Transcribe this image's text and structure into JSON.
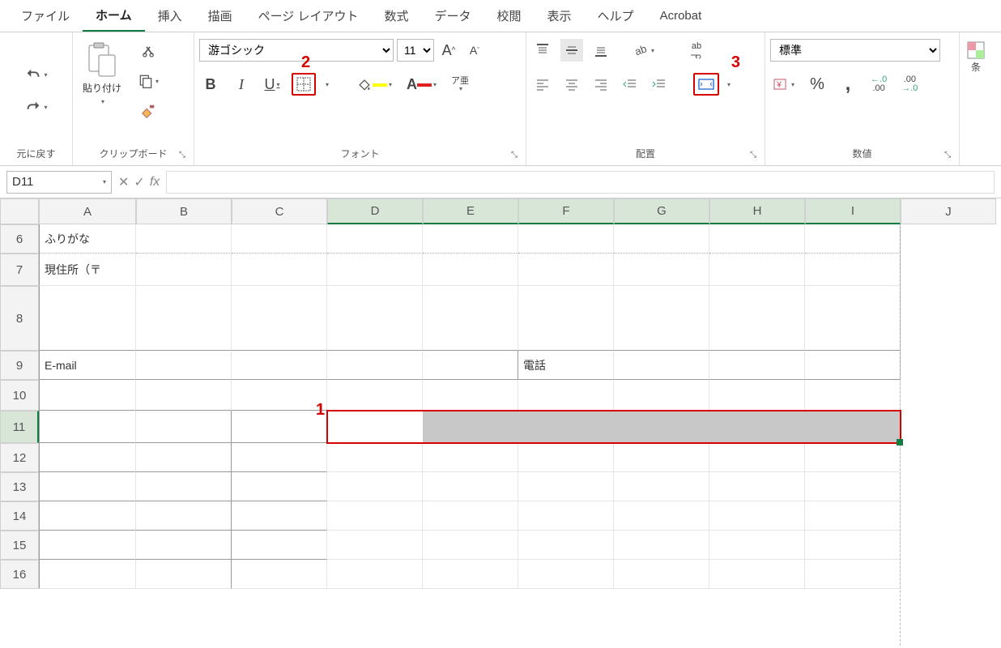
{
  "menu": {
    "items": [
      "ファイル",
      "ホーム",
      "挿入",
      "描画",
      "ページ レイアウト",
      "数式",
      "データ",
      "校閲",
      "表示",
      "ヘルプ",
      "Acrobat"
    ],
    "active_index": 1
  },
  "ribbon": {
    "undo_label": "元に戻す",
    "clipboard": {
      "paste": "貼り付け",
      "label": "クリップボード"
    },
    "font": {
      "family": "游ゴシック",
      "size": "11",
      "label": "フォント",
      "phonetic": "ア亜"
    },
    "alignment": {
      "label": "配置",
      "wrap_abc": "ab"
    },
    "number": {
      "format": "標準",
      "label": "数値"
    },
    "styles": {
      "cond_partial": "条"
    }
  },
  "formula_bar": {
    "cell_ref": "D11",
    "fx": "fx",
    "value": ""
  },
  "columns": [
    "A",
    "B",
    "C",
    "D",
    "E",
    "F",
    "G",
    "H",
    "I",
    "J"
  ],
  "selected_cols": [
    "D",
    "E",
    "F",
    "G",
    "H",
    "I"
  ],
  "rows": [
    "6",
    "7",
    "8",
    "9",
    "10",
    "11",
    "12",
    "13",
    "14",
    "15",
    "16"
  ],
  "selected_row": "11",
  "cells": {
    "A6": "ふりがな",
    "A7_full": "現住所（〒　　　　-　　　　　　　）",
    "A9": "E-mail",
    "F9": "電話"
  },
  "annotations": {
    "n1": "1",
    "n2": "2",
    "n3": "3"
  }
}
